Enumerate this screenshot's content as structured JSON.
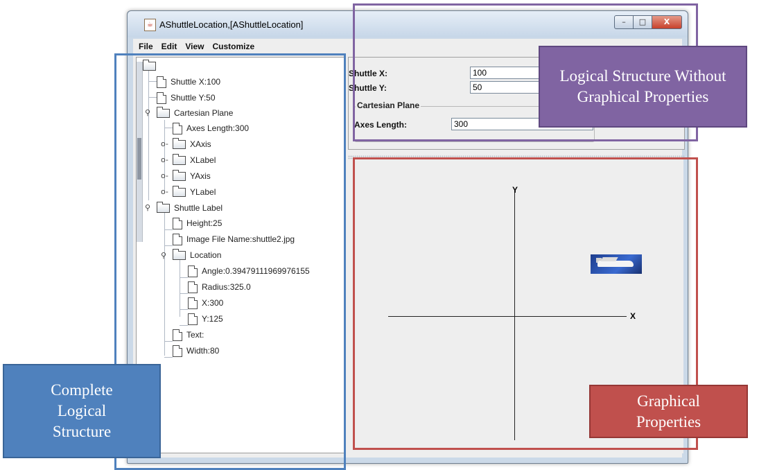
{
  "window": {
    "title": "AShuttleLocation,[AShuttleLocation]",
    "app_icon": "java-icon",
    "controls": {
      "minimize": "–",
      "maximize": "□",
      "close": "X"
    }
  },
  "menubar": {
    "items": [
      "File",
      "Edit",
      "View",
      "Customize"
    ]
  },
  "tree": {
    "root": {
      "icon": "folder-icon"
    },
    "nodes": [
      {
        "label": "Shuttle X:100",
        "icon": "file-icon"
      },
      {
        "label": "Shuttle Y:50",
        "icon": "file-icon"
      },
      {
        "label": "Cartesian Plane",
        "icon": "folder-icon",
        "expanded": true
      },
      {
        "label": "Axes Length:300",
        "icon": "file-icon"
      },
      {
        "label": "XAxis",
        "icon": "folder-icon",
        "expanded": false
      },
      {
        "label": "XLabel",
        "icon": "folder-icon",
        "expanded": false
      },
      {
        "label": "YAxis",
        "icon": "folder-icon",
        "expanded": false
      },
      {
        "label": "YLabel",
        "icon": "folder-icon",
        "expanded": false
      },
      {
        "label": "Shuttle Label",
        "icon": "folder-icon",
        "expanded": true
      },
      {
        "label": "Height:25",
        "icon": "file-icon"
      },
      {
        "label": "Image File Name:shuttle2.jpg",
        "icon": "file-icon"
      },
      {
        "label": "Location",
        "icon": "folder-icon",
        "expanded": true
      },
      {
        "label": "Angle:0.39479111969976155",
        "icon": "file-icon"
      },
      {
        "label": "Radius:325.0",
        "icon": "file-icon"
      },
      {
        "label": "X:300",
        "icon": "file-icon"
      },
      {
        "label": "Y:125",
        "icon": "file-icon"
      },
      {
        "label": "Text:",
        "icon": "file-icon"
      },
      {
        "label": "Width:80",
        "icon": "file-icon"
      }
    ]
  },
  "form": {
    "shuttle_x": {
      "label": "Shuttle X:",
      "value": "100"
    },
    "shuttle_y": {
      "label": "Shuttle Y:",
      "value": "50"
    },
    "group_title": "Cartesian Plane",
    "axes_length": {
      "label": "Axes Length:",
      "value": "300"
    }
  },
  "graphics": {
    "x_label": "X",
    "y_label": "Y",
    "shuttle_image": "shuttle-icon"
  },
  "annotations": {
    "complete": {
      "text": "Complete Logical Structure",
      "color": "#4f81bd"
    },
    "logical": {
      "text": "Logical Structure Without Graphical Properties",
      "color": "#8064a2"
    },
    "graphical": {
      "text": "Graphical Properties",
      "color": "#c0504d"
    }
  }
}
